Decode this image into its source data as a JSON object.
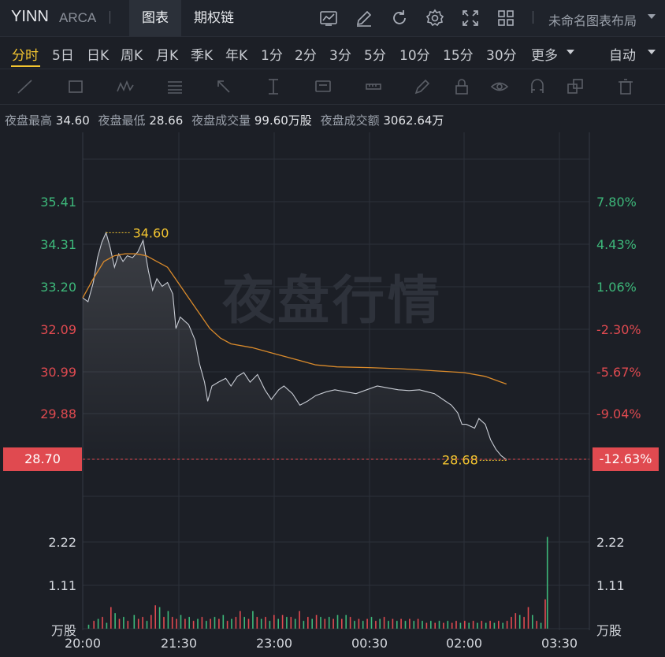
{
  "header": {
    "ticker": "YINN",
    "exchange": "ARCA",
    "tab_chart": "图表",
    "tab_options": "期权链",
    "layout_name": "未命名图表布局"
  },
  "periods": [
    "分时",
    "5日",
    "日K",
    "周K",
    "月K",
    "季K",
    "年K",
    "1分",
    "2分",
    "3分",
    "5分",
    "10分",
    "15分",
    "30分",
    "更多"
  ],
  "active_period": "分时",
  "auto_label": "自动",
  "stats": {
    "high_label": "夜盘最高",
    "high": "34.60",
    "low_label": "夜盘最低",
    "low": "28.66",
    "vol_label": "夜盘成交量",
    "vol": "99.60万股",
    "amt_label": "夜盘成交额",
    "amt": "3062.64万"
  },
  "watermark": "夜盘行情",
  "current_price": "28.70",
  "current_pct": "-12.63%",
  "colors": {
    "up": "#3db87a",
    "down": "#e04a50",
    "price_line": "#c8ccd4",
    "avg_line": "#d98a2b",
    "marker": "#f3c530"
  },
  "chart_data": {
    "type": "line",
    "price_ticks": [
      "35.41",
      "34.31",
      "33.20",
      "32.09",
      "30.99",
      "29.88"
    ],
    "pct_ticks": [
      "7.80%",
      "4.43%",
      "1.06%",
      "-2.30%",
      "-5.67%",
      "-9.04%"
    ],
    "price_range": [
      28.7,
      35.41
    ],
    "x_ticks": [
      "20:00",
      "21:30",
      "23:00",
      "00:30",
      "02:00",
      "03:30"
    ],
    "volume_ticks": [
      "2.22",
      "1.11"
    ],
    "volume_unit": "万股",
    "high_marker": "34.60",
    "low_marker": "28.68",
    "price_series": [
      [
        "20:00",
        32.9
      ],
      [
        "20:05",
        32.8
      ],
      [
        "20:10",
        33.3
      ],
      [
        "20:14",
        33.95
      ],
      [
        "20:18",
        34.35
      ],
      [
        "20:22",
        34.6
      ],
      [
        "20:26",
        34.2
      ],
      [
        "20:30",
        33.7
      ],
      [
        "20:34",
        34.05
      ],
      [
        "20:38",
        33.85
      ],
      [
        "20:42",
        34.0
      ],
      [
        "20:47",
        33.95
      ],
      [
        "20:52",
        34.1
      ],
      [
        "20:57",
        34.4
      ],
      [
        "21:02",
        33.6
      ],
      [
        "21:06",
        33.1
      ],
      [
        "21:10",
        33.4
      ],
      [
        "21:15",
        33.2
      ],
      [
        "21:20",
        33.3
      ],
      [
        "21:25",
        33.0
      ],
      [
        "21:28",
        32.1
      ],
      [
        "21:32",
        32.4
      ],
      [
        "21:36",
        32.3
      ],
      [
        "21:40",
        32.2
      ],
      [
        "21:46",
        31.8
      ],
      [
        "21:50",
        31.2
      ],
      [
        "21:55",
        30.7
      ],
      [
        "21:58",
        30.2
      ],
      [
        "22:02",
        30.6
      ],
      [
        "22:08",
        30.7
      ],
      [
        "22:15",
        30.8
      ],
      [
        "22:20",
        30.6
      ],
      [
        "22:26",
        30.85
      ],
      [
        "22:32",
        30.95
      ],
      [
        "22:38",
        30.7
      ],
      [
        "22:45",
        30.9
      ],
      [
        "22:52",
        30.5
      ],
      [
        "22:58",
        30.25
      ],
      [
        "23:05",
        30.5
      ],
      [
        "23:10",
        30.6
      ],
      [
        "23:18",
        30.4
      ],
      [
        "23:25",
        30.1
      ],
      [
        "23:32",
        30.2
      ],
      [
        "23:40",
        30.35
      ],
      [
        "23:50",
        30.45
      ],
      [
        "23:58",
        30.5
      ],
      [
        "00:08",
        30.45
      ],
      [
        "00:18",
        30.4
      ],
      [
        "00:28",
        30.5
      ],
      [
        "00:38",
        30.6
      ],
      [
        "00:48",
        30.55
      ],
      [
        "00:58",
        30.5
      ],
      [
        "01:08",
        30.48
      ],
      [
        "01:18",
        30.5
      ],
      [
        "01:25",
        30.45
      ],
      [
        "01:32",
        30.4
      ],
      [
        "01:40",
        30.25
      ],
      [
        "01:48",
        30.1
      ],
      [
        "01:54",
        29.9
      ],
      [
        "01:58",
        29.6
      ],
      [
        "02:02",
        29.6
      ],
      [
        "02:10",
        29.5
      ],
      [
        "02:14",
        29.75
      ],
      [
        "02:20",
        29.6
      ],
      [
        "02:25",
        29.2
      ],
      [
        "02:30",
        28.95
      ],
      [
        "02:35",
        28.78
      ],
      [
        "02:40",
        28.68
      ]
    ],
    "avg_series": [
      [
        "20:00",
        32.9
      ],
      [
        "20:10",
        33.4
      ],
      [
        "20:20",
        33.85
      ],
      [
        "20:30",
        34.0
      ],
      [
        "20:40",
        34.05
      ],
      [
        "20:50",
        34.05
      ],
      [
        "21:00",
        34.0
      ],
      [
        "21:10",
        33.85
      ],
      [
        "21:20",
        33.7
      ],
      [
        "21:30",
        33.3
      ],
      [
        "21:40",
        32.9
      ],
      [
        "21:50",
        32.5
      ],
      [
        "22:00",
        32.1
      ],
      [
        "22:10",
        31.85
      ],
      [
        "22:20",
        31.7
      ],
      [
        "22:40",
        31.6
      ],
      [
        "23:00",
        31.45
      ],
      [
        "23:20",
        31.3
      ],
      [
        "23:40",
        31.15
      ],
      [
        "00:00",
        31.1
      ],
      [
        "00:30",
        31.08
      ],
      [
        "01:00",
        31.05
      ],
      [
        "01:30",
        31.0
      ],
      [
        "02:00",
        30.95
      ],
      [
        "02:20",
        30.85
      ],
      [
        "02:35",
        30.7
      ],
      [
        "02:40",
        30.65
      ]
    ],
    "volume_series": [
      [
        5,
        0.1,
        1
      ],
      [
        10,
        0.2,
        0
      ],
      [
        14,
        0.25,
        1
      ],
      [
        18,
        0.3,
        0
      ],
      [
        22,
        0.15,
        1
      ],
      [
        26,
        0.55,
        0
      ],
      [
        30,
        0.4,
        1
      ],
      [
        34,
        0.25,
        0
      ],
      [
        38,
        0.3,
        1
      ],
      [
        42,
        0.2,
        0
      ],
      [
        48,
        0.35,
        1
      ],
      [
        52,
        0.25,
        0
      ],
      [
        56,
        0.3,
        0
      ],
      [
        60,
        0.2,
        1
      ],
      [
        64,
        0.35,
        0
      ],
      [
        68,
        0.6,
        0
      ],
      [
        72,
        0.55,
        1
      ],
      [
        76,
        0.3,
        0
      ],
      [
        80,
        0.45,
        1
      ],
      [
        84,
        0.3,
        0
      ],
      [
        88,
        0.25,
        0
      ],
      [
        92,
        0.35,
        1
      ],
      [
        96,
        0.25,
        0
      ],
      [
        100,
        0.3,
        1
      ],
      [
        104,
        0.2,
        0
      ],
      [
        108,
        0.25,
        1
      ],
      [
        112,
        0.3,
        0
      ],
      [
        116,
        0.2,
        1
      ],
      [
        120,
        0.25,
        0
      ],
      [
        124,
        0.3,
        1
      ],
      [
        128,
        0.25,
        0
      ],
      [
        132,
        0.35,
        1
      ],
      [
        136,
        0.2,
        0
      ],
      [
        140,
        0.25,
        1
      ],
      [
        144,
        0.3,
        0
      ],
      [
        148,
        0.45,
        0
      ],
      [
        152,
        0.3,
        1
      ],
      [
        156,
        0.25,
        0
      ],
      [
        160,
        0.45,
        1
      ],
      [
        164,
        0.3,
        0
      ],
      [
        168,
        0.25,
        1
      ],
      [
        172,
        0.3,
        0
      ],
      [
        176,
        0.2,
        1
      ],
      [
        180,
        0.35,
        0
      ],
      [
        184,
        0.25,
        1
      ],
      [
        188,
        0.35,
        0
      ],
      [
        192,
        0.3,
        1
      ],
      [
        196,
        0.3,
        0
      ],
      [
        200,
        0.25,
        1
      ],
      [
        204,
        0.45,
        0
      ],
      [
        208,
        0.2,
        1
      ],
      [
        212,
        0.3,
        0
      ],
      [
        216,
        0.25,
        1
      ],
      [
        220,
        0.35,
        0
      ],
      [
        224,
        0.3,
        1
      ],
      [
        228,
        0.25,
        0
      ],
      [
        232,
        0.3,
        1
      ],
      [
        236,
        0.25,
        0
      ],
      [
        240,
        0.35,
        1
      ],
      [
        244,
        0.25,
        0
      ],
      [
        248,
        0.35,
        1
      ],
      [
        252,
        0.3,
        0
      ],
      [
        256,
        0.2,
        1
      ],
      [
        260,
        0.25,
        0
      ],
      [
        264,
        0.2,
        1
      ],
      [
        268,
        0.25,
        0
      ],
      [
        272,
        0.3,
        1
      ],
      [
        276,
        0.2,
        0
      ],
      [
        280,
        0.25,
        1
      ],
      [
        284,
        0.3,
        0
      ],
      [
        288,
        0.2,
        1
      ],
      [
        292,
        0.25,
        0
      ],
      [
        296,
        0.2,
        1
      ],
      [
        300,
        0.25,
        0
      ],
      [
        304,
        0.2,
        1
      ],
      [
        308,
        0.25,
        0
      ],
      [
        312,
        0.2,
        1
      ],
      [
        316,
        0.25,
        0
      ],
      [
        320,
        0.2,
        1
      ],
      [
        324,
        0.15,
        0
      ],
      [
        328,
        0.2,
        1
      ],
      [
        332,
        0.15,
        0
      ],
      [
        336,
        0.2,
        1
      ],
      [
        340,
        0.15,
        0
      ],
      [
        344,
        0.2,
        1
      ],
      [
        348,
        0.15,
        0
      ],
      [
        352,
        0.2,
        0
      ],
      [
        356,
        0.15,
        1
      ],
      [
        360,
        0.2,
        0
      ],
      [
        364,
        0.15,
        1
      ],
      [
        368,
        0.2,
        0
      ],
      [
        372,
        0.15,
        1
      ],
      [
        376,
        0.2,
        0
      ],
      [
        380,
        0.15,
        1
      ],
      [
        384,
        0.2,
        0
      ],
      [
        388,
        0.15,
        1
      ],
      [
        392,
        0.2,
        0
      ],
      [
        396,
        0.15,
        1
      ],
      [
        400,
        0.2,
        0
      ],
      [
        404,
        0.3,
        0
      ],
      [
        408,
        0.4,
        0
      ],
      [
        412,
        0.35,
        1
      ],
      [
        416,
        0.3,
        0
      ],
      [
        420,
        0.55,
        0
      ],
      [
        424,
        0.35,
        1
      ],
      [
        428,
        0.2,
        0
      ],
      [
        432,
        0.15,
        1
      ],
      [
        436,
        0.75,
        0
      ],
      [
        438,
        2.35,
        1
      ]
    ]
  }
}
